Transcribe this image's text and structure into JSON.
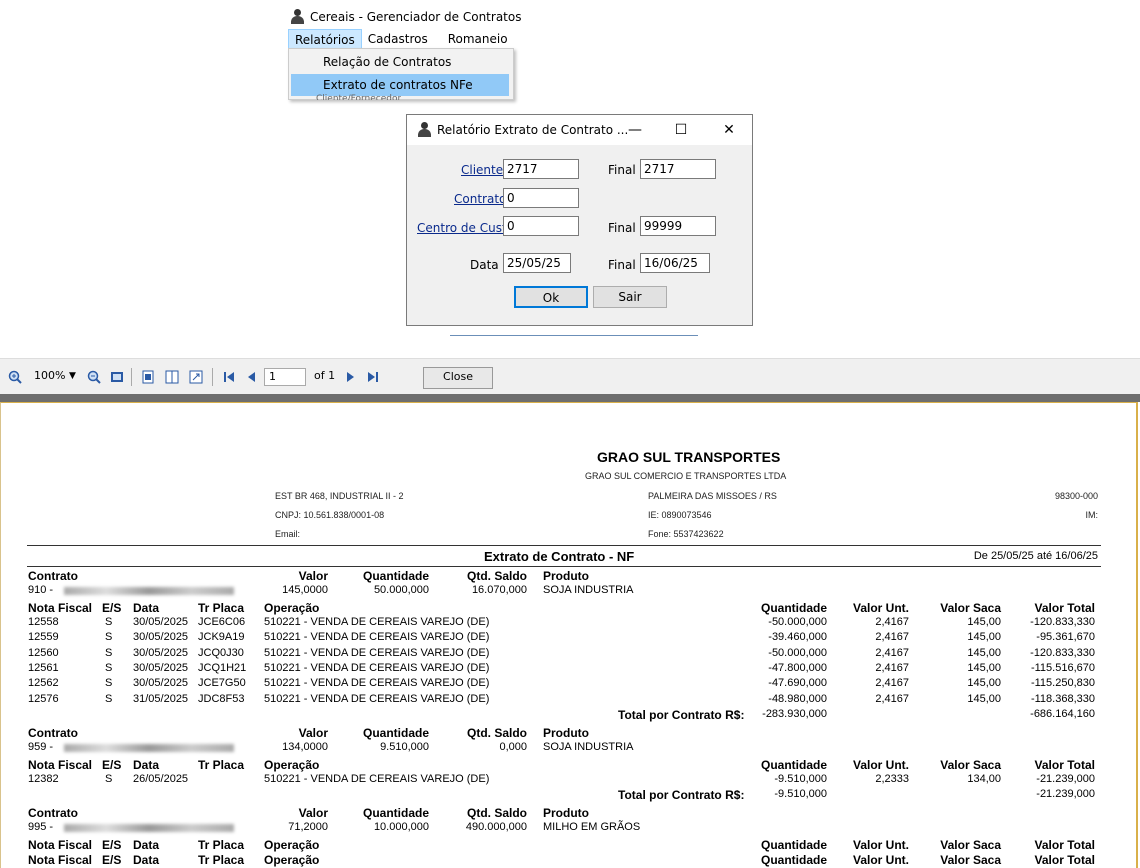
{
  "app": {
    "title": "Cereais - Gerenciador de Contratos",
    "menu": [
      "Relatórios",
      "Cadastros",
      "Romaneio"
    ],
    "dropdown": [
      "Relação de Contratos",
      "Extrato de contratos NFe"
    ],
    "behind_text": "Cliente/Fornecedor"
  },
  "dialog": {
    "title": "Relatório Extrato de Contrato ...",
    "minimize": "—",
    "maximize": "☐",
    "close": "✕",
    "cliente_label": "Cliente",
    "cliente": "2717",
    "final_label": "Final",
    "cliente_final": "2717",
    "contrato_label": "Contrato",
    "contrato": "0",
    "cc_label": "Centro de Custo",
    "cc": "0",
    "cc_final": "99999",
    "data_label": "Data",
    "data": "25/05/25",
    "data_final": "16/06/25",
    "ok": "Ok",
    "sair": "Sair"
  },
  "toolbar": {
    "zoom": "100%",
    "page": "1",
    "of": "of 1",
    "close": "Close"
  },
  "report": {
    "company": "GRAO SUL TRANSPORTES",
    "legal_name": "GRAO SUL COMERCIO E TRANSPORTES LTDA",
    "address": "EST BR 468, INDUSTRIAL II - 2",
    "city": "PALMEIRA DAS MISSOES / RS",
    "cep": "98300-000",
    "cnpj": "CNPJ: 10.561.838/0001-08",
    "ie": "IE: 0890073546",
    "im": "IM:",
    "email": "Email:",
    "fone": "Fone: 5537423622",
    "title": "Extrato de Contrato - NF",
    "period": "De 25/05/25 até 16/06/25",
    "contract_headers": [
      "Contrato",
      "Valor",
      "Quantidade",
      "Qtd. Saldo",
      "Produto"
    ],
    "line_headers": [
      "Nota Fiscal",
      "E/S",
      "Data",
      "Tr Placa",
      "Operação",
      "Quantidade",
      "Valor Unt.",
      "Valor Saca",
      "Valor Total"
    ],
    "total_label": "Total por Contrato R$:",
    "contracts": [
      {
        "num": "910 -",
        "valor": "145,0000",
        "qtd": "50.000,000",
        "saldo": "16.070,000",
        "produto": "SOJA INDUSTRIA",
        "lines": [
          [
            "12558",
            "S",
            "30/05/2025",
            "JCE6C06",
            "510221 - VENDA DE CEREAIS VAREJO (DE)",
            "-50.000,000",
            "2,4167",
            "145,00",
            "-120.833,330"
          ],
          [
            "12559",
            "S",
            "30/05/2025",
            "JCK9A19",
            "510221 - VENDA DE CEREAIS VAREJO (DE)",
            "-39.460,000",
            "2,4167",
            "145,00",
            "-95.361,670"
          ],
          [
            "12560",
            "S",
            "30/05/2025",
            "JCQ0J30",
            "510221 - VENDA DE CEREAIS VAREJO (DE)",
            "-50.000,000",
            "2,4167",
            "145,00",
            "-120.833,330"
          ],
          [
            "12561",
            "S",
            "30/05/2025",
            "JCQ1H21",
            "510221 - VENDA DE CEREAIS VAREJO (DE)",
            "-47.800,000",
            "2,4167",
            "145,00",
            "-115.516,670"
          ],
          [
            "12562",
            "S",
            "30/05/2025",
            "JCE7G50",
            "510221 - VENDA DE CEREAIS VAREJO (DE)",
            "-47.690,000",
            "2,4167",
            "145,00",
            "-115.250,830"
          ],
          [
            "12576",
            "S",
            "31/05/2025",
            "JDC8F53",
            "510221 - VENDA DE CEREAIS VAREJO (DE)",
            "-48.980,000",
            "2,4167",
            "145,00",
            "-118.368,330"
          ]
        ],
        "total_qtd": "-283.930,000",
        "total_valor": "-686.164,160"
      },
      {
        "num": "959 -",
        "valor": "134,0000",
        "qtd": "9.510,000",
        "saldo": "0,000",
        "produto": "SOJA INDUSTRIA",
        "lines": [
          [
            "12382",
            "S",
            "26/05/2025",
            "",
            "510221 - VENDA DE CEREAIS VAREJO (DE)",
            "-9.510,000",
            "2,2333",
            "134,00",
            "-21.239,000"
          ]
        ],
        "total_qtd": "-9.510,000",
        "total_valor": "-21.239,000"
      },
      {
        "num": "995 -",
        "valor": "71,2000",
        "qtd": "10.000,000",
        "saldo": "490.000,000",
        "produto": "MILHO EM GRÃOS",
        "lines": []
      }
    ]
  }
}
